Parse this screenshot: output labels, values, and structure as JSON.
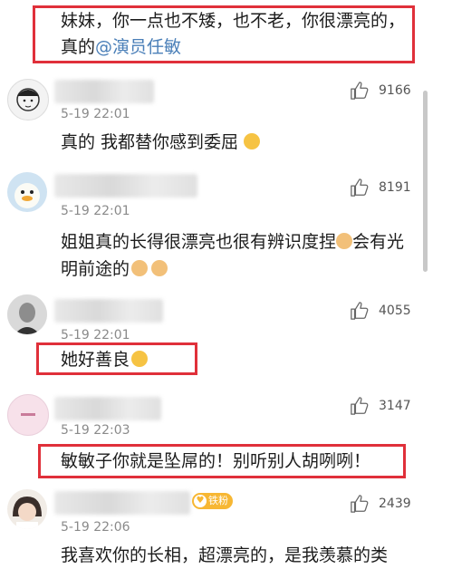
{
  "top_comment": {
    "line1": "妹妹，你一点也不矮，也不老，你很漂亮的，",
    "line2_prefix": "真的",
    "mention": "@演员任敏"
  },
  "comments": [
    {
      "time": "5-19 22:01",
      "likes": "9166",
      "text": "真的 我都替你感到委屈",
      "avatar_icon": "sketch-portrait-avatar"
    },
    {
      "time": "5-19 22:01",
      "likes": "8191",
      "text_line1": "姐姐真的长得很漂亮也很有辨识度捏",
      "text_line1_tail": "会有光",
      "text_line2": "明前途的",
      "avatar_icon": "duck-avatar"
    },
    {
      "time": "5-19 22:01",
      "likes": "4055",
      "text": "她好善良",
      "avatar_icon": "vintage-portrait-avatar"
    },
    {
      "time": "5-19 22:03",
      "likes": "3147",
      "text": "敏敏子你就是坠屌的！别听别人胡咧咧！",
      "avatar_icon": "pink-avatar"
    },
    {
      "time": "5-19 22:06",
      "likes": "2439",
      "text": "我喜欢你的长相，超漂亮的，是我羡慕的类",
      "badge": "铁粉",
      "avatar_icon": "girl-avatar"
    }
  ],
  "colors": {
    "highlight_border": "#e0303a",
    "mention": "#4a7fb8",
    "badge": "#f7b733"
  }
}
